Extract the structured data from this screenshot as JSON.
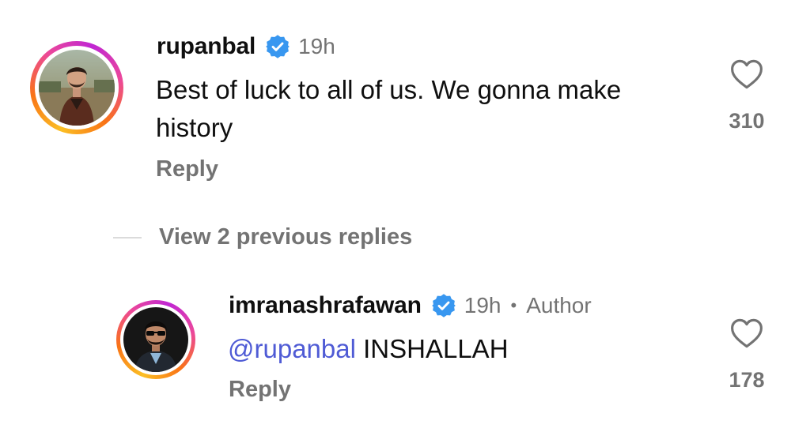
{
  "comments": [
    {
      "username": "rupanbal",
      "verified": true,
      "time": "19h",
      "text": "Best of luck to all of us. We gonna make history",
      "reply_label": "Reply",
      "likes": "310",
      "avatar_icon": "avatar-photo-man-leather-jacket"
    },
    {
      "username": "imranashrafawan",
      "verified": true,
      "time": "19h",
      "separator": "•",
      "badge": "Author",
      "mention": "@rupanbal",
      "text": " INSHALLAH",
      "reply_label": "Reply",
      "likes": "178",
      "avatar_icon": "avatar-photo-man-sunglasses"
    }
  ],
  "view_replies_label": "View 2 previous replies",
  "colors": {
    "verified_badge": "#3897f0",
    "mention": "#4f5bd5",
    "secondary_text": "#737373"
  },
  "icons": {
    "like": "heart-outline-icon",
    "verified": "verified-badge-icon"
  }
}
